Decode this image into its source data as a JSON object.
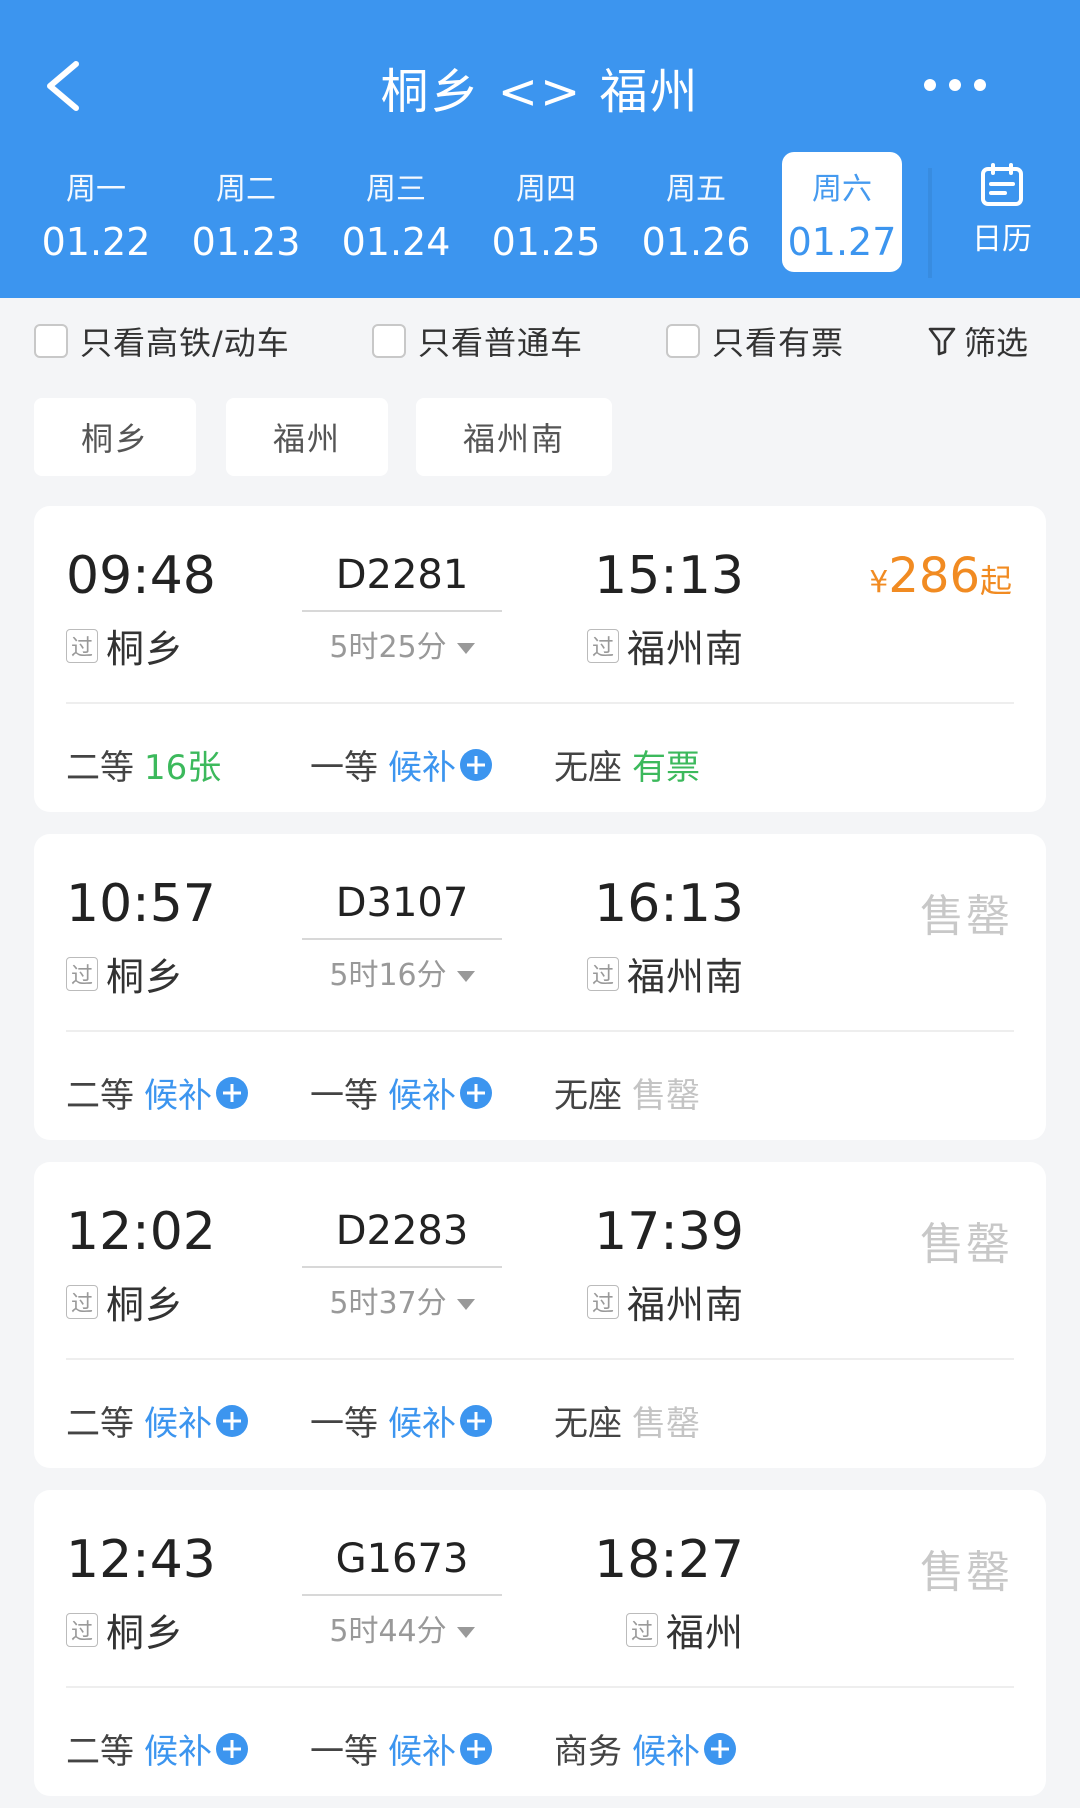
{
  "header": {
    "title": "桐乡 <> 福州",
    "calendar_label": "日历",
    "colors": {
      "primary": "#3c95ef",
      "price": "#f18b22",
      "available": "#3cb95c"
    }
  },
  "dates": [
    {
      "weekday": "周一",
      "date": "01.22"
    },
    {
      "weekday": "周二",
      "date": "01.23"
    },
    {
      "weekday": "周三",
      "date": "01.24"
    },
    {
      "weekday": "周四",
      "date": "01.25"
    },
    {
      "weekday": "周五",
      "date": "01.26"
    },
    {
      "weekday": "周六",
      "date": "01.27",
      "selected": true
    }
  ],
  "filters": {
    "high_speed": "只看高铁/动车",
    "regular": "只看普通车",
    "available": "只看有票",
    "filter_button": "筛选"
  },
  "stations": [
    "桐乡",
    "福州",
    "福州南"
  ],
  "pass_label": "过",
  "trains": [
    {
      "dep_time": "09:48",
      "dep_station": "桐乡",
      "train_no": "D2281",
      "duration": "5时25分",
      "arr_time": "15:13",
      "arr_station": "福州南",
      "price_currency": "¥",
      "price_amount": "286",
      "price_suffix": "起",
      "seats": [
        {
          "class": "二等",
          "status": "16张"
        },
        {
          "class": "一等",
          "status": "候补"
        },
        {
          "class": "无座",
          "status": "有票"
        }
      ]
    },
    {
      "dep_time": "10:57",
      "dep_station": "桐乡",
      "train_no": "D3107",
      "duration": "5时16分",
      "arr_time": "16:13",
      "arr_station": "福州南",
      "sold_out": "售罄",
      "seats": [
        {
          "class": "二等",
          "status": "候补"
        },
        {
          "class": "一等",
          "status": "候补"
        },
        {
          "class": "无座",
          "status": "售罄"
        }
      ]
    },
    {
      "dep_time": "12:02",
      "dep_station": "桐乡",
      "train_no": "D2283",
      "duration": "5时37分",
      "arr_time": "17:39",
      "arr_station": "福州南",
      "sold_out": "售罄",
      "seats": [
        {
          "class": "二等",
          "status": "候补"
        },
        {
          "class": "一等",
          "status": "候补"
        },
        {
          "class": "无座",
          "status": "售罄"
        }
      ]
    },
    {
      "dep_time": "12:43",
      "dep_station": "桐乡",
      "train_no": "G1673",
      "duration": "5时44分",
      "arr_time": "18:27",
      "arr_station": "福州",
      "sold_out": "售罄",
      "seats": [
        {
          "class": "二等",
          "status": "候补"
        },
        {
          "class": "一等",
          "status": "候补"
        },
        {
          "class": "商务",
          "status": "候补"
        }
      ]
    }
  ]
}
